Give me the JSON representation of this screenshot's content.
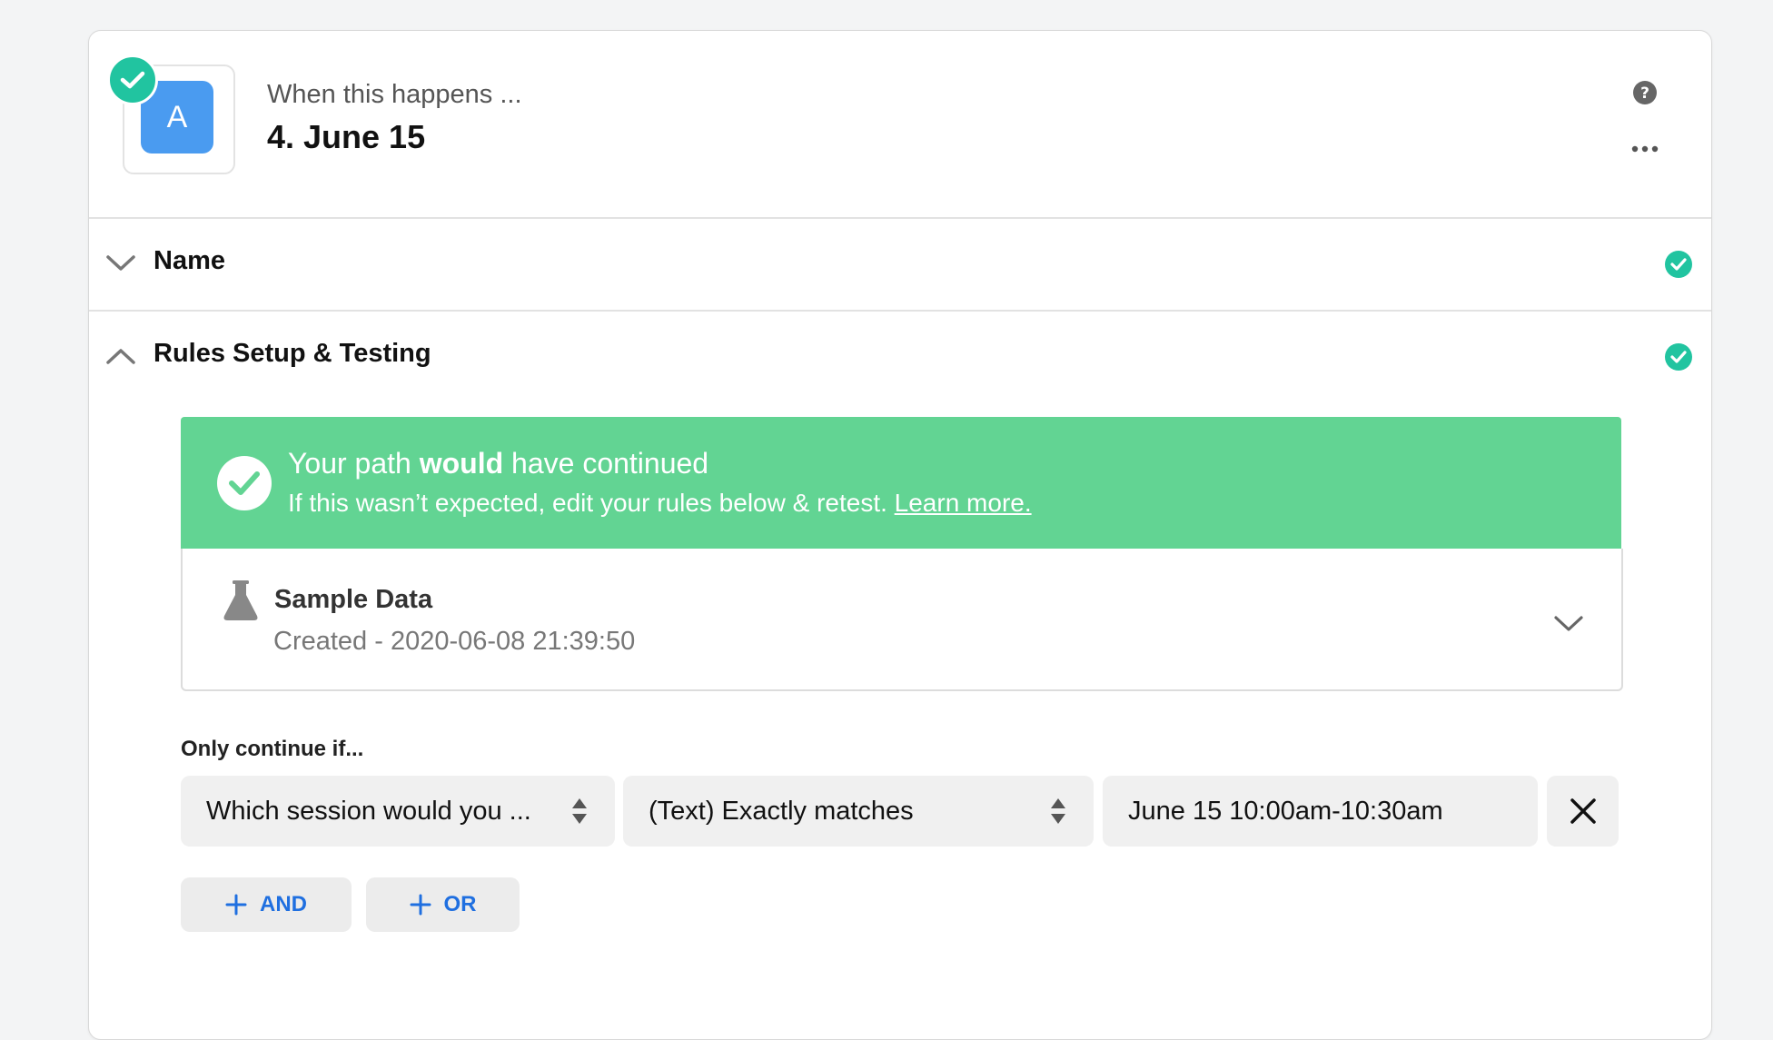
{
  "header": {
    "app_letter": "A",
    "subtitle": "When this happens ...",
    "title": "4. June 15"
  },
  "sections": [
    {
      "label": "Name",
      "expanded": false,
      "complete": true
    },
    {
      "label": "Rules Setup & Testing",
      "expanded": true,
      "complete": true
    }
  ],
  "banner": {
    "title_prefix": "Your path ",
    "title_bold": "would",
    "title_suffix": " have continued",
    "subtitle": "If this wasn’t expected, edit your rules below & retest. ",
    "link": "Learn more."
  },
  "sample": {
    "title": "Sample Data",
    "created": "Created - 2020-06-08 21:39:50"
  },
  "rules": {
    "label": "Only continue if...",
    "field": "Which session would you ...",
    "condition": "(Text) Exactly matches",
    "value": "June 15 10:00am-10:30am",
    "and_label": "AND",
    "or_label": "OR"
  },
  "colors": {
    "accent_green": "#21c4a0",
    "banner_green": "#62d493",
    "app_blue": "#4a9bf0",
    "link_blue": "#1f6fe0"
  }
}
